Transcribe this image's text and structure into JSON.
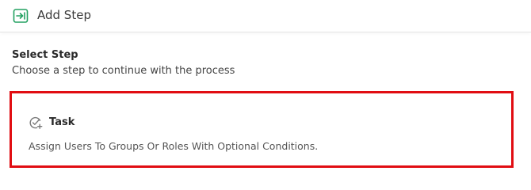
{
  "header": {
    "title": "Add Step",
    "icon": "step-in-icon",
    "icon_color": "#22a060"
  },
  "section": {
    "title": "Select Step",
    "subtitle": "Choose a step to continue with the process"
  },
  "steps": [
    {
      "icon": "task-check-add-icon",
      "title": "Task",
      "description": "Assign Users To Groups Or Roles With Optional Conditions.",
      "selected": true,
      "highlight_color": "#e10d12"
    }
  ]
}
